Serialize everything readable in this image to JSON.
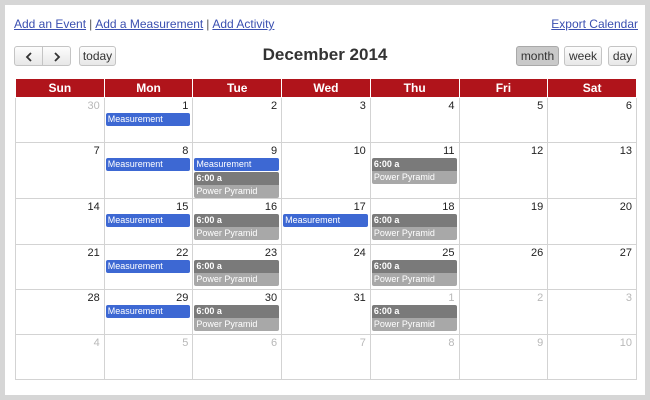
{
  "links": {
    "add_event": "Add an Event",
    "add_measurement": "Add a Measurement",
    "add_activity": "Add Activity",
    "separator": "|",
    "export": "Export Calendar"
  },
  "toolbar": {
    "prev_icon": "chevron-left-icon",
    "next_icon": "chevron-right-icon",
    "today": "today",
    "title": "December 2014",
    "views": {
      "month": "month",
      "week": "week",
      "day": "day"
    },
    "active_view": "month"
  },
  "colors": {
    "header_red": "#b0141b",
    "measurement_blue": "#3d68d3",
    "activity_time_gray": "#7a7a7a",
    "activity_label_gray": "#a8a8a8"
  },
  "weekdays": [
    "Sun",
    "Mon",
    "Tue",
    "Wed",
    "Thu",
    "Fri",
    "Sat"
  ],
  "weeks": [
    [
      {
        "day": "30",
        "other": true,
        "events": []
      },
      {
        "day": "1",
        "events": [
          {
            "type": "measurement",
            "label": "Measurement"
          }
        ]
      },
      {
        "day": "2",
        "events": []
      },
      {
        "day": "3",
        "events": []
      },
      {
        "day": "4",
        "events": []
      },
      {
        "day": "5",
        "events": []
      },
      {
        "day": "6",
        "events": []
      }
    ],
    [
      {
        "day": "7",
        "events": []
      },
      {
        "day": "8",
        "events": [
          {
            "type": "measurement",
            "label": "Measurement"
          }
        ]
      },
      {
        "day": "9",
        "events": [
          {
            "type": "measurement",
            "label": "Measurement"
          },
          {
            "type": "activity",
            "time": "6:00 a",
            "label": "Power Pyramid"
          }
        ]
      },
      {
        "day": "10",
        "events": []
      },
      {
        "day": "11",
        "events": [
          {
            "type": "activity",
            "time": "6:00 a",
            "label": "Power Pyramid"
          }
        ]
      },
      {
        "day": "12",
        "events": []
      },
      {
        "day": "13",
        "events": []
      }
    ],
    [
      {
        "day": "14",
        "events": []
      },
      {
        "day": "15",
        "events": [
          {
            "type": "measurement",
            "label": "Measurement"
          }
        ]
      },
      {
        "day": "16",
        "events": [
          {
            "type": "activity",
            "time": "6:00 a",
            "label": "Power Pyramid"
          }
        ]
      },
      {
        "day": "17",
        "events": [
          {
            "type": "measurement",
            "label": "Measurement"
          }
        ]
      },
      {
        "day": "18",
        "events": [
          {
            "type": "activity",
            "time": "6:00 a",
            "label": "Power Pyramid"
          }
        ]
      },
      {
        "day": "19",
        "events": []
      },
      {
        "day": "20",
        "events": []
      }
    ],
    [
      {
        "day": "21",
        "events": []
      },
      {
        "day": "22",
        "events": [
          {
            "type": "measurement",
            "label": "Measurement"
          }
        ]
      },
      {
        "day": "23",
        "events": [
          {
            "type": "activity",
            "time": "6:00 a",
            "label": "Power Pyramid"
          }
        ]
      },
      {
        "day": "24",
        "events": []
      },
      {
        "day": "25",
        "events": [
          {
            "type": "activity",
            "time": "6:00 a",
            "label": "Power Pyramid"
          }
        ]
      },
      {
        "day": "26",
        "events": []
      },
      {
        "day": "27",
        "events": []
      }
    ],
    [
      {
        "day": "28",
        "events": []
      },
      {
        "day": "29",
        "events": [
          {
            "type": "measurement",
            "label": "Measurement"
          }
        ]
      },
      {
        "day": "30",
        "events": [
          {
            "type": "activity",
            "time": "6:00 a",
            "label": "Power Pyramid"
          }
        ]
      },
      {
        "day": "31",
        "events": []
      },
      {
        "day": "1",
        "other": true,
        "events": [
          {
            "type": "activity",
            "time": "6:00 a",
            "label": "Power Pyramid"
          }
        ]
      },
      {
        "day": "2",
        "other": true,
        "events": []
      },
      {
        "day": "3",
        "other": true,
        "events": []
      }
    ],
    [
      {
        "day": "4",
        "other": true,
        "events": []
      },
      {
        "day": "5",
        "other": true,
        "events": []
      },
      {
        "day": "6",
        "other": true,
        "events": []
      },
      {
        "day": "7",
        "other": true,
        "events": []
      },
      {
        "day": "8",
        "other": true,
        "events": []
      },
      {
        "day": "9",
        "other": true,
        "events": []
      },
      {
        "day": "10",
        "other": true,
        "events": []
      }
    ]
  ]
}
